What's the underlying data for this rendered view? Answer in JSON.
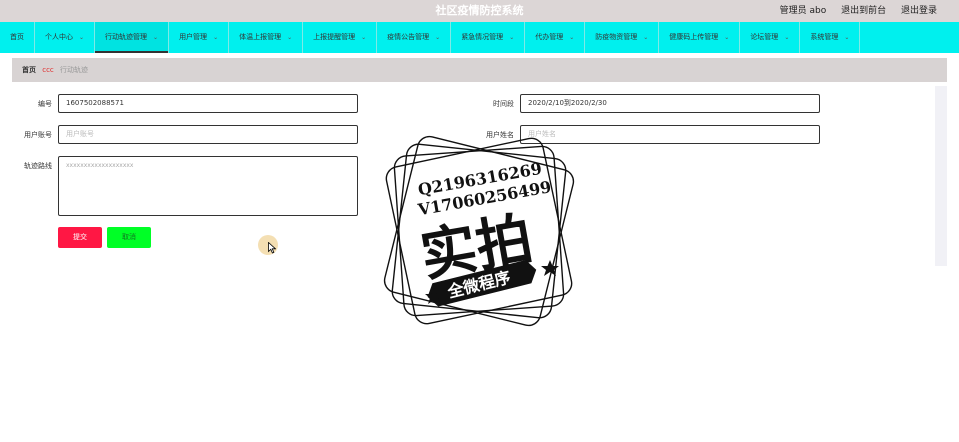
{
  "app": {
    "title": "社区疫情防控系统",
    "admin_label": "管理员 abo",
    "back_frontend": "退出到前台",
    "logout": "退出登录"
  },
  "nav": {
    "items": [
      {
        "label": "首页",
        "dropdown": false,
        "active": false
      },
      {
        "label": "个人中心",
        "dropdown": true,
        "active": false
      },
      {
        "label": "行动轨迹管理",
        "dropdown": true,
        "active": true
      },
      {
        "label": "用户管理",
        "dropdown": true,
        "active": false
      },
      {
        "label": "体温上报管理",
        "dropdown": true,
        "active": false
      },
      {
        "label": "上报提醒管理",
        "dropdown": true,
        "active": false
      },
      {
        "label": "疫情公告管理",
        "dropdown": true,
        "active": false
      },
      {
        "label": "紧急情况管理",
        "dropdown": true,
        "active": false
      },
      {
        "label": "代办管理",
        "dropdown": true,
        "active": false
      },
      {
        "label": "防疫物资管理",
        "dropdown": true,
        "active": false
      },
      {
        "label": "健康码上传管理",
        "dropdown": true,
        "active": false
      },
      {
        "label": "论坛管理",
        "dropdown": true,
        "active": false
      },
      {
        "label": "系统管理",
        "dropdown": true,
        "active": false
      }
    ]
  },
  "breadcrumb": {
    "home": "首页",
    "separator": "ccc",
    "current": "行动轨迹"
  },
  "form": {
    "number_label": "编号",
    "number_value": "1607502088571",
    "period_label": "时间段",
    "period_value": "2020/2/10到2020/2/30",
    "account_label": "用户账号",
    "account_placeholder": "用户账号",
    "name_label": "用户姓名",
    "name_placeholder": "用户姓名",
    "route_label": "轨迹路线",
    "route_value": "xxxxxxxxxxxxxxxxxxx",
    "submit_label": "提交",
    "cancel_label": "取消"
  },
  "watermark": {
    "line1": "Q2196316269",
    "line2": "V17060256499",
    "big_text": "实拍",
    "ribbon_text": "全微程序"
  },
  "colors": {
    "topbar": "#dcd6d6",
    "navbar": "#00f0ee",
    "submit": "#ff1744",
    "cancel": "#00ff26"
  }
}
